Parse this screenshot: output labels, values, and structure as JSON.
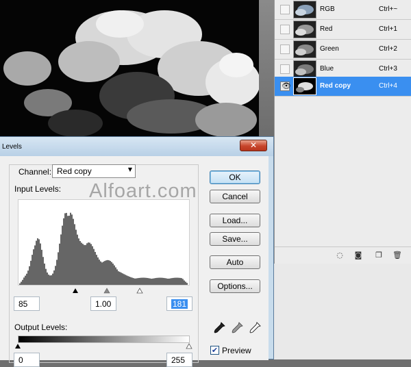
{
  "channels_panel": {
    "rows": [
      {
        "name": "RGB",
        "shortcut": "Ctrl+~",
        "visible": false,
        "selected": false
      },
      {
        "name": "Red",
        "shortcut": "Ctrl+1",
        "visible": false,
        "selected": false
      },
      {
        "name": "Green",
        "shortcut": "Ctrl+2",
        "visible": false,
        "selected": false
      },
      {
        "name": "Blue",
        "shortcut": "Ctrl+3",
        "visible": false,
        "selected": false
      },
      {
        "name": "Red copy",
        "shortcut": "Ctrl+4",
        "visible": true,
        "selected": true
      }
    ],
    "eye_glyph": "👁",
    "bottom_icons": [
      "load-selection-icon",
      "save-selection-icon",
      "new-channel-icon",
      "trash-icon"
    ]
  },
  "dialog": {
    "title": "Levels",
    "close_label": "✕",
    "channel_label": "Channel:",
    "channel_value": "Red copy",
    "channel_arrow": "▼",
    "input_levels_label": "Input Levels:",
    "watermark": "Alfoart.com",
    "input_black": "85",
    "input_gamma": "1.00",
    "input_white": "181",
    "output_levels_label": "Output Levels:",
    "output_black": "0",
    "output_white": "255",
    "buttons": {
      "ok": "OK",
      "cancel": "Cancel",
      "load": "Load...",
      "save": "Save...",
      "auto": "Auto",
      "options": "Options..."
    },
    "preview_label": "Preview",
    "preview_checked": true,
    "check_glyph": "✔"
  },
  "colors": {
    "selection_blue": "#3a8ff0",
    "close_red": "#c7452b"
  }
}
